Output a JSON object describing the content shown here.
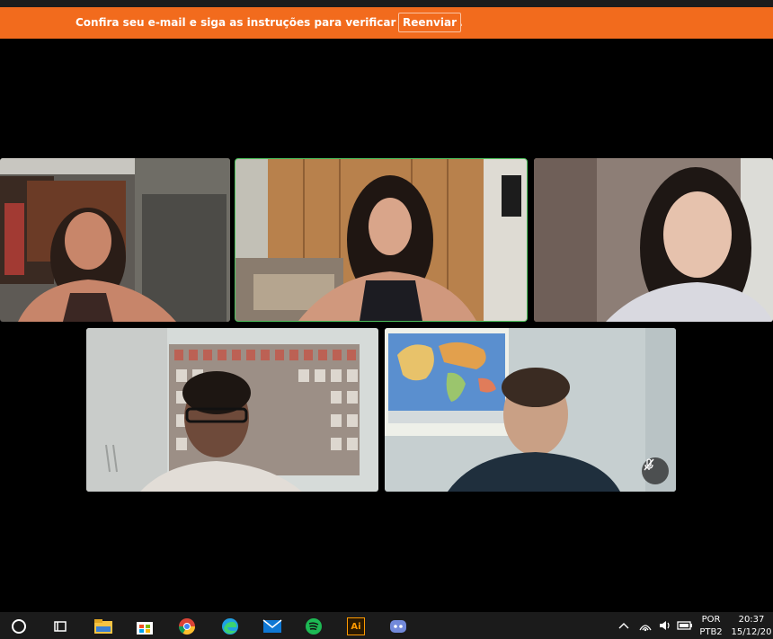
{
  "banner": {
    "message": "Confira seu e-mail e siga as instruções para verificar sua conta.",
    "resend_label": "Reenviar"
  },
  "colors": {
    "banner": "#f26b1d",
    "active_speaker_border": "#4fc35e"
  },
  "participants": [
    {
      "tile": "participant-tile-1",
      "active": false,
      "muted": false
    },
    {
      "tile": "participant-tile-2",
      "active": true,
      "muted": false
    },
    {
      "tile": "participant-tile-3",
      "active": false,
      "muted": false
    },
    {
      "tile": "participant-tile-4",
      "active": false,
      "muted": false
    },
    {
      "tile": "participant-tile-5",
      "active": false,
      "muted": true
    }
  ],
  "taskbar": {
    "apps": [
      "start-circle-icon",
      "task-view-icon",
      "file-explorer-icon",
      "microsoft-store-icon",
      "chrome-icon",
      "edge-icon",
      "mail-icon",
      "spotify-icon",
      "illustrator-icon",
      "discord-icon"
    ],
    "illustrator_label": "Ai",
    "language_line1": "POR",
    "language_line2": "PTB2",
    "time": "20:37",
    "date": "15/12/20"
  }
}
